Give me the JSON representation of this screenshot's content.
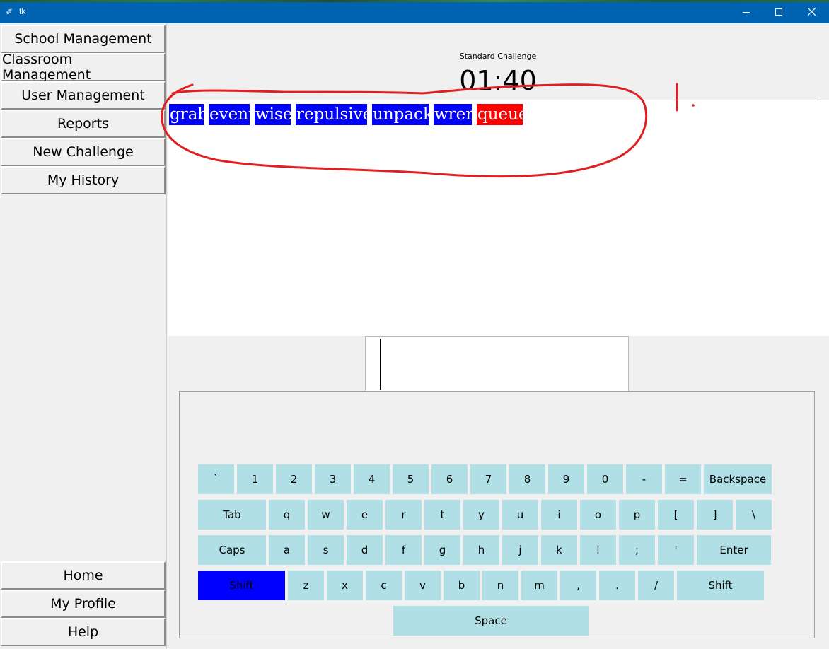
{
  "window": {
    "title": "tk",
    "icon": "feather-icon",
    "title_color": "#0063b1"
  },
  "sidebar": {
    "top_items": [
      {
        "label": "School Management"
      },
      {
        "label": "Classroom Management"
      },
      {
        "label": "User Management"
      },
      {
        "label": "Reports"
      },
      {
        "label": "New Challenge"
      },
      {
        "label": "My History"
      }
    ],
    "bottom_items": [
      {
        "label": "Home"
      },
      {
        "label": "My Profile"
      },
      {
        "label": "Help"
      }
    ]
  },
  "challenge": {
    "label": "Standard Challenge",
    "timer": "01:40"
  },
  "words": [
    {
      "text": "grab",
      "state": "done",
      "color": "#0000ff"
    },
    {
      "text": "event",
      "state": "done",
      "color": "#0000ff"
    },
    {
      "text": "wise",
      "state": "done",
      "color": "#0000ff"
    },
    {
      "text": "repulsive",
      "state": "done",
      "color": "#0000ff"
    },
    {
      "text": "unpack",
      "state": "done",
      "color": "#0000ff"
    },
    {
      "text": "wren",
      "state": "done",
      "color": "#0000ff"
    },
    {
      "text": "queue",
      "state": "current",
      "color": "#ff0000"
    }
  ],
  "input": {
    "value": ""
  },
  "keyboard": {
    "key_color": "#b0dfe5",
    "active_color": "#0000ff",
    "rows": [
      [
        "`",
        "1",
        "2",
        "3",
        "4",
        "5",
        "6",
        "7",
        "8",
        "9",
        "0",
        "-",
        "=",
        "Backspace"
      ],
      [
        "Tab",
        "q",
        "w",
        "e",
        "r",
        "t",
        "y",
        "u",
        "i",
        "o",
        "p",
        "[",
        "]",
        "\\"
      ],
      [
        "Caps",
        "a",
        "s",
        "d",
        "f",
        "g",
        "h",
        "j",
        "k",
        "l",
        ";",
        "'",
        "Enter"
      ],
      [
        "Shift",
        "z",
        "x",
        "c",
        "v",
        "b",
        "n",
        "m",
        ",",
        ".",
        "/",
        "Shift"
      ],
      [
        "Space"
      ]
    ],
    "active_key": "Shift"
  },
  "annotation": {
    "mark": "I.",
    "color": "#e02020"
  }
}
